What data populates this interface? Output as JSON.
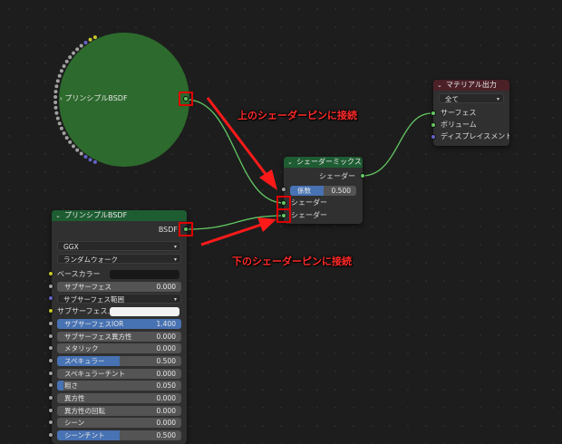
{
  "collapsed_node": {
    "label": "プリンシプルBSDF"
  },
  "principled_node": {
    "title": "プリンシプルBSDF",
    "output_label": "BSDF",
    "distribution": "GGX",
    "subsurface_method": "ランダムウォーク",
    "properties": [
      {
        "label": "ベースカラー",
        "type": "color",
        "socket": "yellow"
      },
      {
        "label": "サブサーフェス",
        "value": "0.000",
        "socket": "grey",
        "fill": 0
      },
      {
        "label": "サブサーフェス範囲",
        "type": "dropdown",
        "socket": "blue"
      },
      {
        "label": "サブサーフェス...",
        "type": "color-white",
        "socket": "yellow"
      },
      {
        "label": "サブサーフェスIOR",
        "value": "1.400",
        "socket": "grey",
        "fill": 1
      },
      {
        "label": "サブサーフェス異方性",
        "value": "0.000",
        "socket": "grey",
        "fill": 0
      },
      {
        "label": "メタリック",
        "value": "0.000",
        "socket": "grey",
        "fill": 0
      },
      {
        "label": "スペキュラー",
        "value": "0.500",
        "socket": "grey",
        "fill": 0.5
      },
      {
        "label": "スペキュラーチント",
        "value": "0.000",
        "socket": "grey",
        "fill": 0
      },
      {
        "label": "粗さ",
        "value": "0.050",
        "socket": "grey",
        "fill": 0.05
      },
      {
        "label": "異方性",
        "value": "0.000",
        "socket": "grey",
        "fill": 0
      },
      {
        "label": "異方性の回転",
        "value": "0.000",
        "socket": "grey",
        "fill": 0
      },
      {
        "label": "シーン",
        "value": "0.000",
        "socket": "grey",
        "fill": 0
      },
      {
        "label": "シーンチント",
        "value": "0.500",
        "socket": "grey",
        "fill": 0.5
      }
    ]
  },
  "mix_node": {
    "title": "シェーダーミックス",
    "output_label": "シェーダー",
    "factor_label": "係数",
    "factor_value": "0.500",
    "factor_fill": 0.5,
    "input1": "シェーダー",
    "input2": "シェーダー"
  },
  "output_node": {
    "title": "マテリアル出力",
    "target": "全て",
    "inputs": [
      "サーフェス",
      "ボリューム",
      "ディスプレイスメント"
    ]
  },
  "annotations": {
    "top": "上のシェーダーピンに接続",
    "bottom": "下のシェーダーピンに接続"
  },
  "colors": {
    "accent_red": "#ff2a2a",
    "shader_socket": "#63c763",
    "value_socket": "#a1a1a1",
    "color_socket": "#c7c729",
    "vector_socket": "#6363c7",
    "slider_fill": "#4772b3"
  }
}
